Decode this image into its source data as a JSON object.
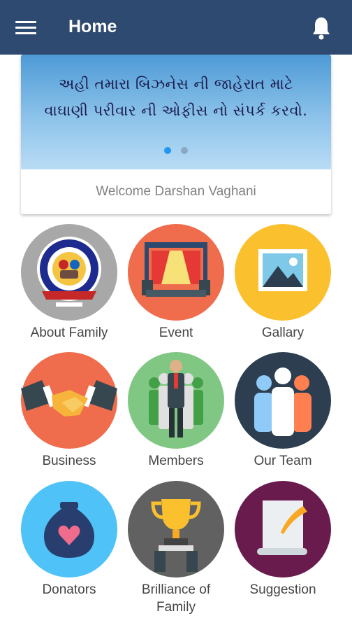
{
  "appbar": {
    "title": "Home",
    "background": "#2f4a70",
    "menu_icon": "hamburger-menu-icon",
    "notification_icon": "bell-icon"
  },
  "banner": {
    "line1": "અહી તમારા બિઝનેસ ની જાહેરાત માટે",
    "line2": "વાઘાણી પરીવાર ની ઓફીસ નો સંપર્ક કરવો.",
    "slides_total": 2,
    "active_slide": 1,
    "active_dot_color": "#2196f3"
  },
  "welcome_text": "Welcome Darshan Vaghani",
  "menu": [
    {
      "label": "About Family",
      "icon": "family-logo-icon",
      "color": "#9e9e9e"
    },
    {
      "label": "Event",
      "icon": "stage-event-icon",
      "color": "#ef6c4c"
    },
    {
      "label": "Gallary",
      "icon": "picture-icon",
      "color": "#fbc02d"
    },
    {
      "label": "Business",
      "icon": "handshake-icon",
      "color": "#ef6c4c"
    },
    {
      "label": "Members",
      "icon": "members-icon",
      "color": "#81c784"
    },
    {
      "label": "Our Team",
      "icon": "team-icon",
      "color": "#2c3e50"
    },
    {
      "label": "Donators",
      "icon": "donation-bag-icon",
      "color": "#4fc3f7"
    },
    {
      "label": "Brilliance of Family",
      "icon": "trophy-icon",
      "color": "#616161"
    },
    {
      "label": "Suggestion",
      "icon": "quill-scroll-icon",
      "color": "#6a1b4d"
    }
  ]
}
